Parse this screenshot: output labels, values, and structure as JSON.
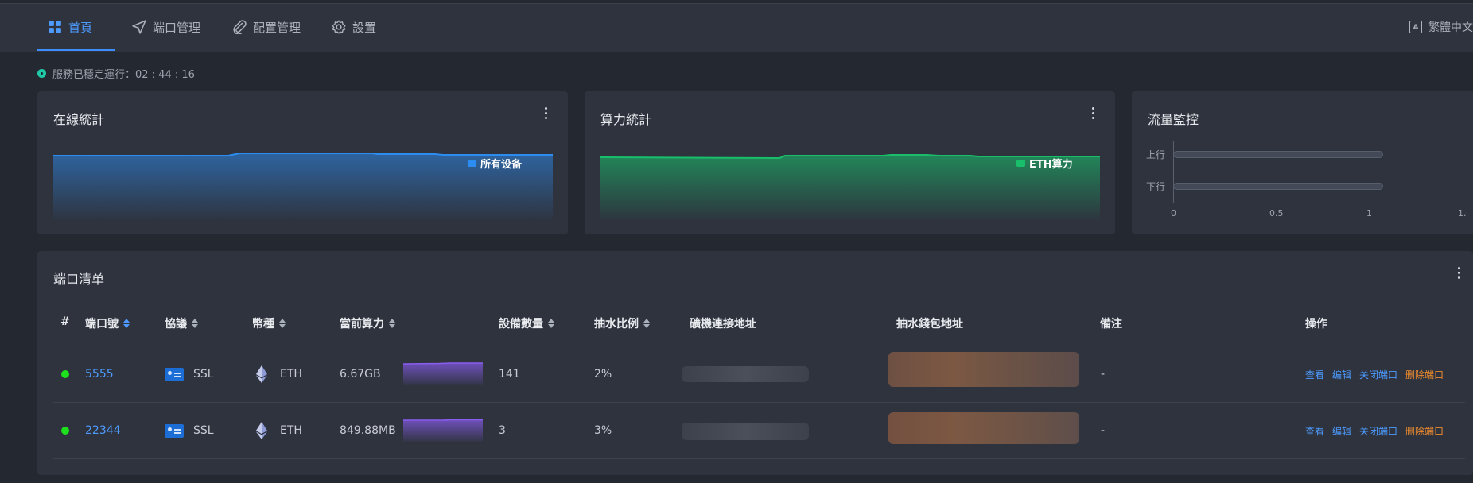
{
  "nav": {
    "items": [
      {
        "label": "首頁",
        "icon": "dashboard-icon",
        "active": true
      },
      {
        "label": "端口管理",
        "icon": "send-icon",
        "active": false
      },
      {
        "label": "配置管理",
        "icon": "paperclip-icon",
        "active": false
      },
      {
        "label": "設置",
        "icon": "gear-icon",
        "active": false
      }
    ],
    "language": "繁體中文"
  },
  "status": {
    "uptime_text": "服務已穩定運行：02 : 44 : 16"
  },
  "cards": {
    "online": {
      "title": "在線統計",
      "legend": "所有设备",
      "color": "#2d8cf0"
    },
    "hashrate": {
      "title": "算力統計",
      "legend": "ETH算力",
      "color": "#19be6b"
    },
    "traffic": {
      "title": "流量監控",
      "rows": [
        "上行",
        "下行"
      ],
      "ticks": [
        "0",
        "0.5",
        "1",
        "1."
      ]
    }
  },
  "table": {
    "title": "端口清单",
    "headers": {
      "index": "#",
      "port": "端口號",
      "protocol": "協議",
      "coin": "幣種",
      "hashrate": "當前算力",
      "devices": "設備數量",
      "fee": "抽水比例",
      "miner_address": "礦機連接地址",
      "wallet_address": "抽水錢包地址",
      "remark": "備注",
      "actions": "操作"
    },
    "rows": [
      {
        "port": "5555",
        "protocol": "SSL",
        "coin": "ETH",
        "hashrate": "6.67GB",
        "devices": "141",
        "fee": "2%",
        "remark": "-"
      },
      {
        "port": "22344",
        "protocol": "SSL",
        "coin": "ETH",
        "hashrate": "849.88MB",
        "devices": "3",
        "fee": "3%",
        "remark": "-"
      }
    ],
    "actions": {
      "view": "查看",
      "edit": "编辑",
      "close": "关闭端口",
      "delete": "删除端口"
    }
  },
  "colors": {
    "accent": "#3f8cff",
    "online": "#1ee01e",
    "danger": "#f08c2e",
    "spark": "#8a5cf0"
  }
}
